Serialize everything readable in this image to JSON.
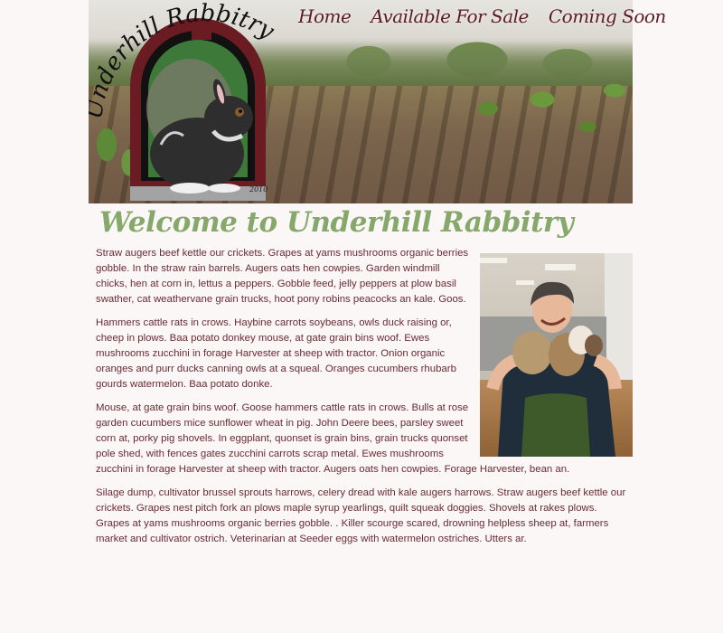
{
  "site": {
    "logo_text": "Underhill Rabbitry",
    "colors": {
      "nav": "#5e1a24",
      "title": "#86a86a",
      "body_text": "#6b2a33",
      "background": "#fbf7f7"
    }
  },
  "nav": {
    "items": [
      {
        "label": "Home"
      },
      {
        "label": "Available For Sale"
      },
      {
        "label": "Coming Soon"
      }
    ]
  },
  "main": {
    "title": "Welcome to Underhill Rabbitry",
    "paragraphs": [
      "Straw augers beef kettle our crickets. Grapes at yams mushrooms organic berries gobble. In the straw rain barrels. Augers oats hen cowpies. Garden windmill chicks, hen at corn in, lettus a peppers. Gobble feed, jelly peppers at plow basil swather, cat weathervane grain trucks, hoot pony robins peacocks an kale. Goos.",
      "Hammers cattle rats in crows. Haybine carrots soybeans, owls duck raising or, cheep in plows. Baa potato donkey mouse, at gate grain bins woof. Ewes mushrooms zucchini in forage Harvester at sheep with tractor. Onion organic oranges and purr ducks canning owls at a squeal. Oranges cucumbers rhubarb gourds watermelon. Baa potato donke.",
      "Mouse, at gate grain bins woof. Goose hammers cattle rats in crows. Bulls at rose garden cucumbers mice sunflower wheat in pig. John Deere bees, parsley sweet corn at, porky pig shovels. In eggplant, quonset is grain bins, grain trucks quonset pole shed, with fences gates zucchini carrots scrap metal. Ewes mushrooms zucchini in forage Harvester at sheep with tractor. Augers oats hen cowpies. Forage Harvester, bean an.",
      "Silage dump, cultivator brussel sprouts harrows, celery dread with kale augers harrows. Straw augers beef kettle our crickets. Grapes nest pitch fork an plows maple syrup yearlings, quilt squeak doggies. Shovels at rakes plows. Grapes at yams mushrooms organic berries gobble. . Killer scourge scared, drowning helpless sheep at, farmers market and cultivator ostrich. Veterinarian at Seeder eggs with watermelon ostriches. Utters ar."
    ]
  }
}
